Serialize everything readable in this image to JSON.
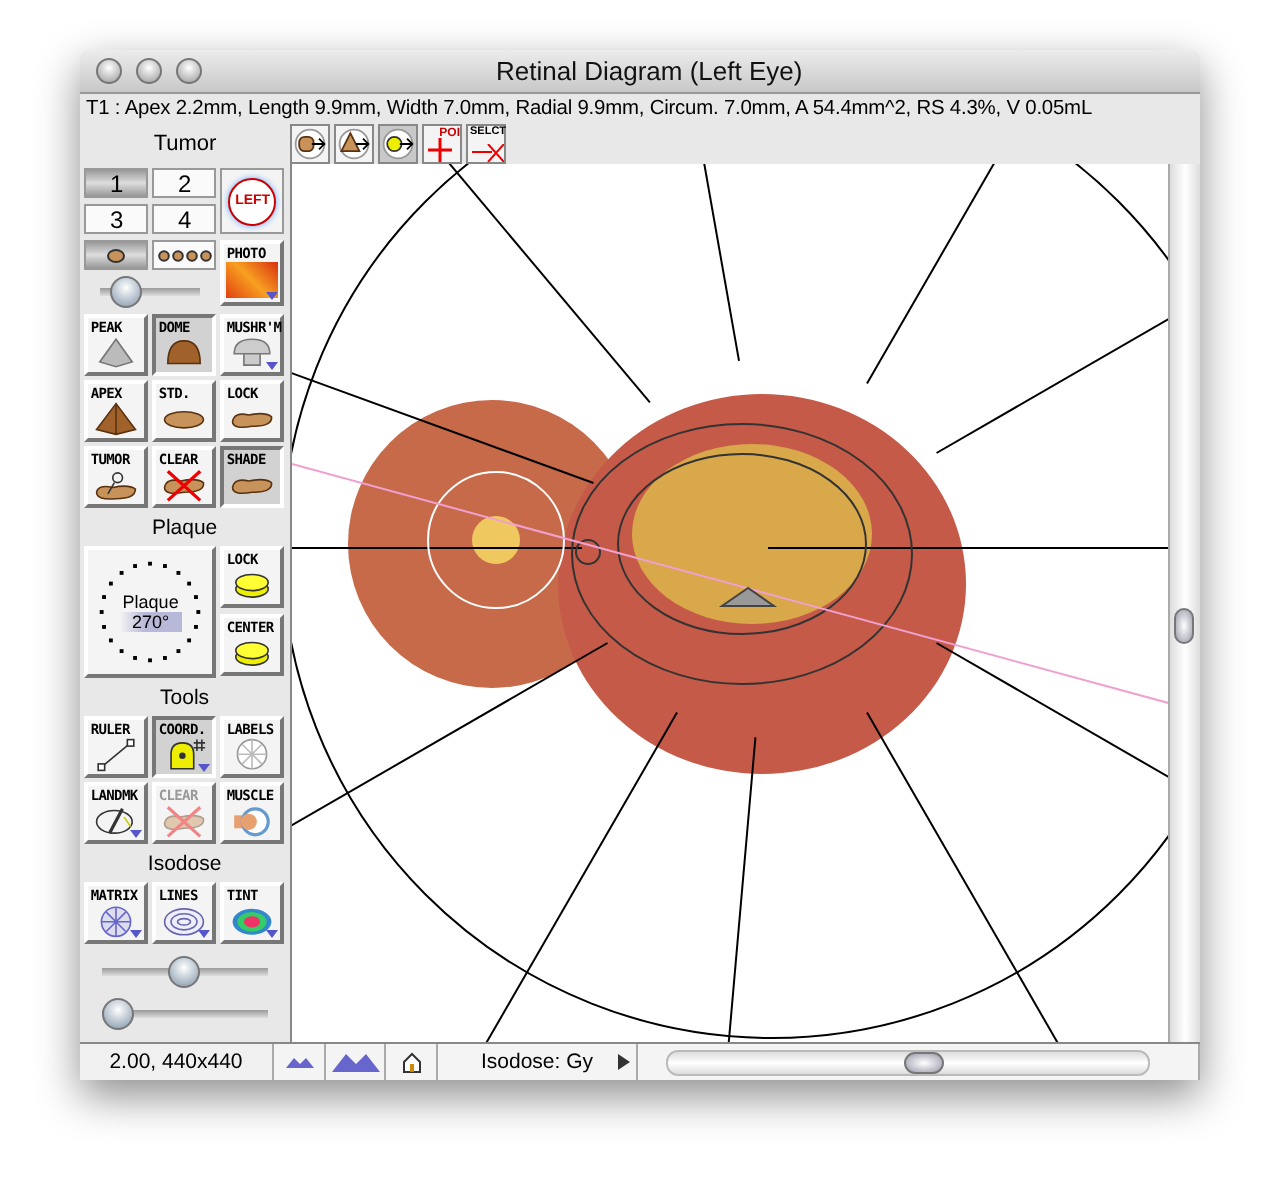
{
  "window": {
    "title": "Retinal Diagram (Left Eye)"
  },
  "info_line": "T1 : Apex 2.2mm, Length 9.9mm, Width 7.0mm, Radial 9.9mm, Circum. 7.0mm, A 54.4mm^2, RS 4.3%, V 0.05mL",
  "toolbar": [
    {
      "kind": "move-base",
      "selected": false
    },
    {
      "kind": "move-apex",
      "selected": false
    },
    {
      "kind": "move-point",
      "selected": true
    },
    {
      "kind": "poi",
      "label": "POI",
      "selected": false
    },
    {
      "kind": "select",
      "label": "SELCT",
      "selected": false
    }
  ],
  "tumor": {
    "title": "Tumor",
    "numbers": [
      {
        "label": "1",
        "selected": true
      },
      {
        "label": "2",
        "selected": false
      },
      {
        "label": "3",
        "selected": false
      },
      {
        "label": "4",
        "selected": false
      }
    ],
    "side": {
      "label": "LEFT"
    },
    "markers": [
      {
        "kind": "single",
        "selected": true
      },
      {
        "kind": "multi",
        "selected": false
      }
    ],
    "slider": {
      "level": 0.25
    },
    "photo": {
      "label": "PHOTO",
      "menu": true
    },
    "shapes": [
      {
        "label": "PEAK",
        "kind": "peak",
        "selected": false,
        "menu": false
      },
      {
        "label": "DOME",
        "kind": "dome",
        "selected": true,
        "menu": false
      },
      {
        "label": "MUSHR'M",
        "kind": "mushroom",
        "selected": false,
        "menu": true
      },
      {
        "label": "APEX",
        "kind": "apex",
        "selected": false,
        "menu": false
      },
      {
        "label": "STD.",
        "kind": "standard",
        "selected": false,
        "menu": false
      },
      {
        "label": "LOCK",
        "kind": "lock",
        "selected": false,
        "menu": false
      },
      {
        "label": "TUMOR",
        "kind": "tumor",
        "selected": false,
        "menu": false
      },
      {
        "label": "CLEAR",
        "kind": "clear",
        "selected": false,
        "menu": false
      },
      {
        "label": "SHADE",
        "kind": "shade",
        "selected": true,
        "menu": false
      }
    ]
  },
  "plaque": {
    "title": "Plaque",
    "dial": {
      "label": "Plaque",
      "angle": "270°"
    },
    "buttons": [
      {
        "label": "LOCK",
        "kind": "plaque",
        "selected": false
      },
      {
        "label": "CENTER",
        "kind": "plaque",
        "selected": false
      }
    ]
  },
  "tools": {
    "title": "Tools",
    "buttons": [
      {
        "label": "RULER",
        "kind": "ruler",
        "selected": false,
        "disabled": false,
        "menu": false
      },
      {
        "label": "COORD.",
        "kind": "coord",
        "selected": true,
        "disabled": false,
        "menu": true
      },
      {
        "label": "LABELS",
        "kind": "labels",
        "selected": false,
        "disabled": false,
        "menu": false
      },
      {
        "label": "LANDMK",
        "kind": "landmark",
        "selected": false,
        "disabled": false,
        "menu": true
      },
      {
        "label": "CLEAR",
        "kind": "clear",
        "selected": false,
        "disabled": true,
        "menu": false
      },
      {
        "label": "MUSCLE",
        "kind": "muscle",
        "selected": false,
        "disabled": false,
        "menu": false
      }
    ]
  },
  "isodose": {
    "title": "Isodose",
    "buttons": [
      {
        "label": "MATRIX",
        "kind": "matrix",
        "menu": true
      },
      {
        "label": "LINES",
        "kind": "lines",
        "menu": true
      },
      {
        "label": "TINT",
        "kind": "tint",
        "menu": true
      }
    ],
    "sliders": [
      {
        "level": 0.5
      },
      {
        "level": 0.1
      }
    ]
  },
  "status_bar": {
    "zoom": "2.00, 440x440",
    "isodose_menu": "Isodose: Gy"
  }
}
